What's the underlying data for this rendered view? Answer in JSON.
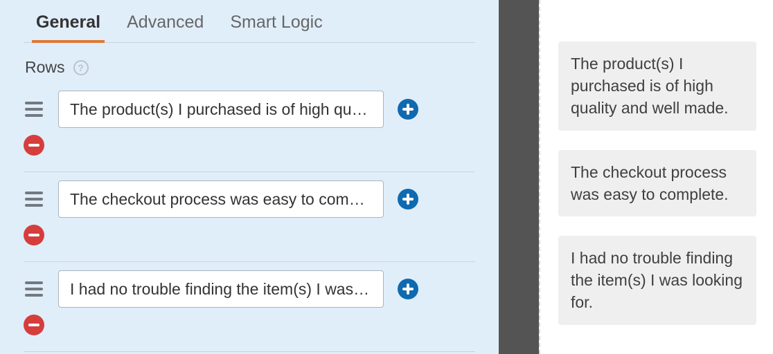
{
  "tabs": {
    "general": "General",
    "advanced": "Advanced",
    "smart_logic": "Smart Logic"
  },
  "section": {
    "rows_label": "Rows"
  },
  "rows": [
    {
      "value": "The product(s) I purchased is of high quality and well made."
    },
    {
      "value": "The checkout process was easy to complete."
    },
    {
      "value": "I had no trouble finding the item(s) I was looking for."
    }
  ],
  "preview": [
    "The product(s) I purchased is of high quality and well made.",
    "The checkout process was easy to complete.",
    "I had no trouble finding the item(s) I was looking for."
  ]
}
